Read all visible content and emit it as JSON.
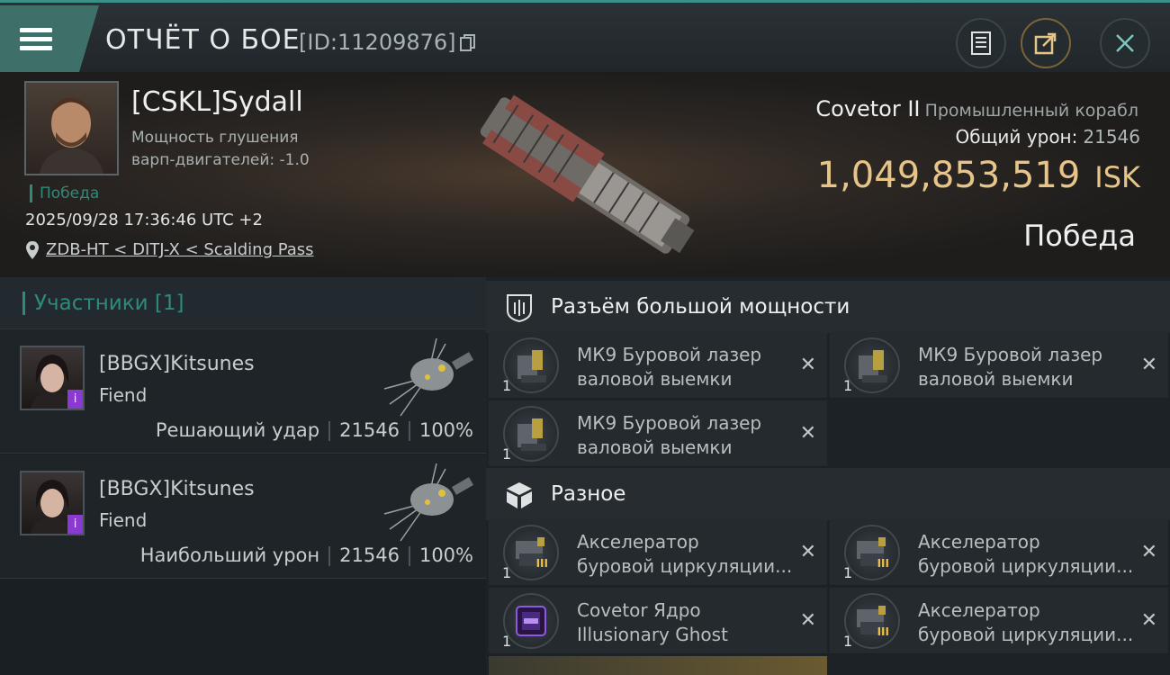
{
  "header": {
    "title": "ОТЧЁТ О БОЕ",
    "report_id": "[ID:11209876]"
  },
  "victim": {
    "name": "[CSKL]Sydall",
    "stat_line1": "Мощность глушения",
    "stat_line2": "варп-двигателей: -1.0",
    "status": "Победа",
    "datetime": "2025/09/28 17:36:46 UTC +2",
    "location": "ZDB-HT < DITJ-X < Scalding Pass",
    "ship_name": "Covetor II",
    "ship_class": "Промышленный корабл",
    "damage_label": "Общий урон:",
    "damage_value": "21546",
    "isk_value": "1,049,853,519",
    "isk_unit": "ISK",
    "result": "Победа"
  },
  "participants": {
    "title": "Участники [1]",
    "rows": [
      {
        "name": "[BBGX]Kitsunes",
        "ship": "Fiend",
        "role": "Решающий удар",
        "damage": "21546",
        "percent": "100%"
      },
      {
        "name": "[BBGX]Kitsunes",
        "ship": "Fiend",
        "role": "Наибольший урон",
        "damage": "21546",
        "percent": "100%"
      }
    ]
  },
  "sections": [
    {
      "title": "Разъём большой мощности",
      "icon": "high-slot-icon",
      "modules": [
        {
          "line1": "МК9 Буровой лазер",
          "line2": "валовой выемки",
          "qty": "1",
          "icon": "mining-laser-icon"
        },
        {
          "line1": "МК9 Буровой лазер",
          "line2": "валовой выемки",
          "qty": "1",
          "icon": "mining-laser-icon"
        },
        {
          "line1": "МК9 Буровой лазер",
          "line2": "валовой выемки",
          "qty": "1",
          "icon": "mining-laser-icon"
        }
      ]
    },
    {
      "title": "Разное",
      "icon": "cube-icon",
      "modules": [
        {
          "line1": "Акселератор",
          "line2": "буровой циркуляции...",
          "qty": "1",
          "icon": "accelerator-icon",
          "tier": "III"
        },
        {
          "line1": "Акселератор",
          "line2": "буровой циркуляции...",
          "qty": "1",
          "icon": "accelerator-icon",
          "tier": "III"
        },
        {
          "line1": "Covetor Ядро",
          "line2": "Illusionary Ghost",
          "qty": "1",
          "icon": "core-icon"
        },
        {
          "line1": "Акселератор",
          "line2": "буровой циркуляции...",
          "qty": "1",
          "icon": "accelerator-icon",
          "tier": "III"
        }
      ]
    }
  ],
  "colors": {
    "accent": "#2e8a7a",
    "isk": "#e7c488",
    "badge": "#8a3ad0"
  }
}
